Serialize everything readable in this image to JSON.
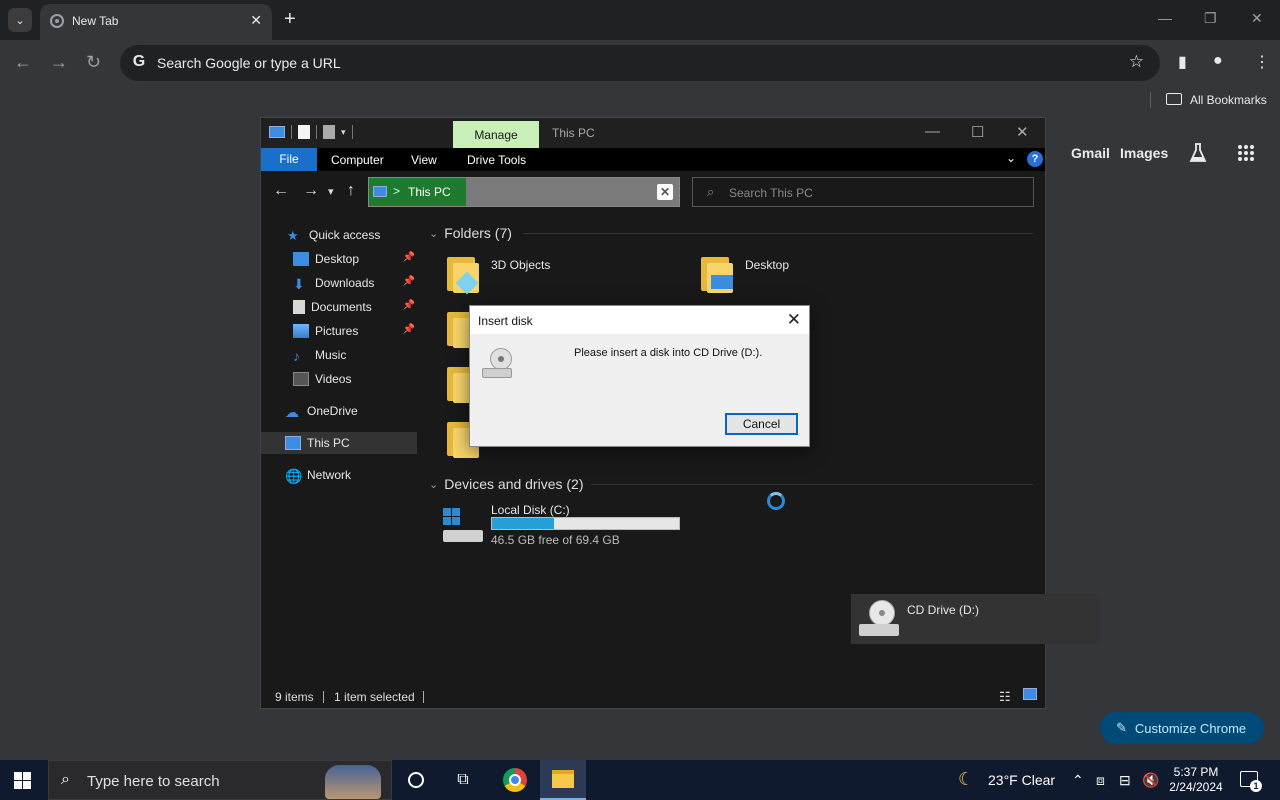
{
  "browser": {
    "tab_title": "New Tab",
    "omnibox_placeholder": "Search Google or type a URL",
    "bookmarks_label": "All Bookmarks",
    "ntp_links": {
      "gmail": "Gmail",
      "images": "Images"
    },
    "customize_label": "Customize Chrome"
  },
  "explorer": {
    "manage_tab": "Manage",
    "window_title": "This PC",
    "ribbon": {
      "file": "File",
      "computer": "Computer",
      "view": "View",
      "drive_tools": "Drive Tools"
    },
    "address": "This PC",
    "search_placeholder": "Search This PC",
    "nav": {
      "quick_access": "Quick access",
      "items": [
        "Desktop",
        "Downloads",
        "Documents",
        "Pictures",
        "Music",
        "Videos"
      ],
      "onedrive": "OneDrive",
      "this_pc": "This PC",
      "network": "Network"
    },
    "folders_header": "Folders (7)",
    "folders_visible": [
      "3D Objects",
      "Desktop"
    ],
    "devices_header": "Devices and drives (2)",
    "drive_c": {
      "name": "Local Disk (C:)",
      "free_text": "46.5 GB free of 69.4 GB",
      "used_fraction": 0.33
    },
    "drive_d": {
      "name": "CD Drive (D:)"
    },
    "status": {
      "items": "9 items",
      "selected": "1 item selected"
    }
  },
  "dialog": {
    "title": "Insert disk",
    "message": "Please insert a disk into CD Drive (D:).",
    "cancel": "Cancel"
  },
  "taskbar": {
    "search_placeholder": "Type here to search",
    "weather": "23°F  Clear",
    "time": "5:37 PM",
    "date": "2/24/2024",
    "notif_count": "1"
  },
  "colors": {
    "accent": "#1a6fc9",
    "manage_tab": "#c8f0b8",
    "capacity": "#26a0da"
  }
}
